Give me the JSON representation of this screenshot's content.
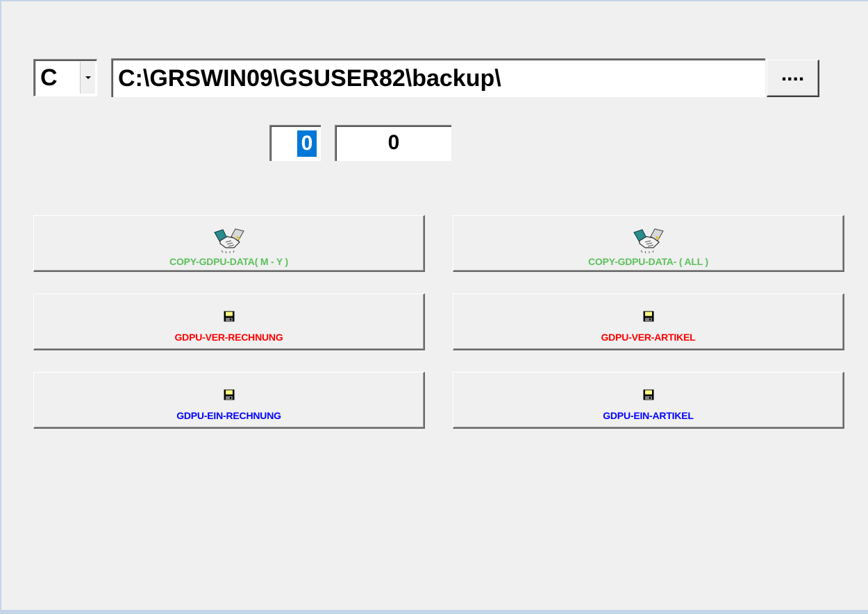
{
  "drive": {
    "value": "C"
  },
  "path": {
    "value": "C:\\GRSWIN09\\GSUSER82\\backup\\"
  },
  "browse_button": {
    "label": "...."
  },
  "counters": {
    "first": "0",
    "second": "0"
  },
  "buttons": {
    "copy_m_y": {
      "label": "COPY-GDPU-DATA( M - Y )",
      "color": "#5cc05c",
      "icon": "handshake-icon"
    },
    "copy_all": {
      "label": "COPY-GDPU-DATA- ( ALL )",
      "color": "#5cc05c",
      "icon": "handshake-icon"
    },
    "ver_rechnung": {
      "label": "GDPU-VER-RECHNUNG",
      "color": "#ff0000",
      "icon": "floppy-disk-icon"
    },
    "ver_artikel": {
      "label": "GDPU-VER-ARTIKEL",
      "color": "#ff0000",
      "icon": "floppy-disk-icon"
    },
    "ein_rechnung": {
      "label": "GDPU-EIN-RECHNUNG",
      "color": "#0000ff",
      "icon": "floppy-disk-icon"
    },
    "ein_artikel": {
      "label": "GDPU-EIN-ARTIKEL",
      "color": "#0000ff",
      "icon": "floppy-disk-icon"
    }
  }
}
